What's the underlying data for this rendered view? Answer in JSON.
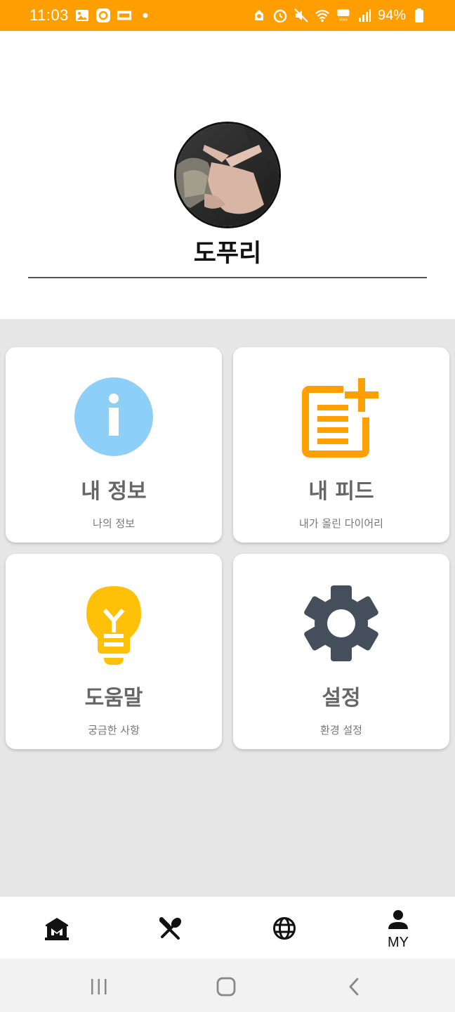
{
  "status_bar": {
    "time": "11:03",
    "battery": "94%",
    "left_icons": [
      "gallery-icon",
      "app-icon",
      "ticket-icon",
      "dot-icon"
    ],
    "right_icons": [
      "recycle-icon",
      "alarm-icon",
      "mute-icon",
      "wifi-icon",
      "hd-voice-icon",
      "signal-icon",
      "battery-icon"
    ],
    "color": "#FF9E00"
  },
  "profile": {
    "username": "도푸리",
    "avatar_icon": "profile-photo"
  },
  "cards": [
    {
      "title": "내 정보",
      "subtitle": "나의 정보",
      "icon": "info-icon",
      "color": "#8ECFF8"
    },
    {
      "title": "내 피드",
      "subtitle": "내가 올린 다이어리",
      "icon": "add-post-icon",
      "color": "#FFA000"
    },
    {
      "title": "도움말",
      "subtitle": "궁금한 사항",
      "icon": "lightbulb-icon",
      "color": "#FFC107"
    },
    {
      "title": "설정",
      "subtitle": "환경 설정",
      "icon": "gear-icon",
      "color": "#454F5B"
    }
  ],
  "bottom_nav": {
    "items": [
      {
        "icon": "museum-icon",
        "label": ""
      },
      {
        "icon": "restaurant-icon",
        "label": ""
      },
      {
        "icon": "globe-icon",
        "label": ""
      },
      {
        "icon": "person-icon",
        "label": "MY"
      }
    ]
  },
  "system_nav": {
    "icons": [
      "recents-icon",
      "home-icon",
      "back-icon"
    ]
  }
}
